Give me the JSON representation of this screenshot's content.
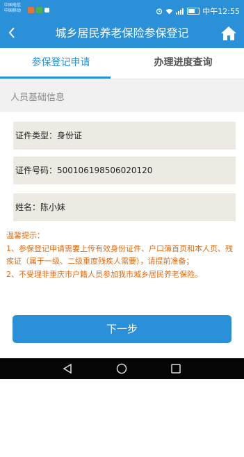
{
  "status_bar": {
    "carrier_1": "中国电信",
    "carrier_2": "中国移动",
    "time": "中午12:55",
    "icons": [
      "alarm-icon",
      "wifi-icon",
      "signal-icon",
      "battery-icon"
    ]
  },
  "header": {
    "title": "城乡居民养老保险参保登记",
    "back_icon": "back-arrow-icon",
    "home_icon": "home-icon"
  },
  "tabs": [
    {
      "label": "参保登记申请",
      "active": true
    },
    {
      "label": "办理进度查询",
      "active": false
    }
  ],
  "section": {
    "title": "人员基础信息"
  },
  "fields": [
    {
      "label": "证件类型：",
      "value": "身份证"
    },
    {
      "label": "证件号码：",
      "value": "500106198506020120"
    },
    {
      "label": "姓名：",
      "value": "陈小妹"
    }
  ],
  "tips": {
    "title": "温馨提示：",
    "items": [
      "1、参保登记申请需要上传有效身份证件、户口簿首页和本人页、残疾证（属于一级、二级重度残疾人需要），请提前准备；",
      "2、不受理非重庆市户籍人员参加我市城乡居民养老保险。"
    ]
  },
  "actions": {
    "next_label": "下一步"
  },
  "colors": {
    "primary": "#2a90d8",
    "tip_text": "#e36b12",
    "field_bg": "#edeae4"
  }
}
